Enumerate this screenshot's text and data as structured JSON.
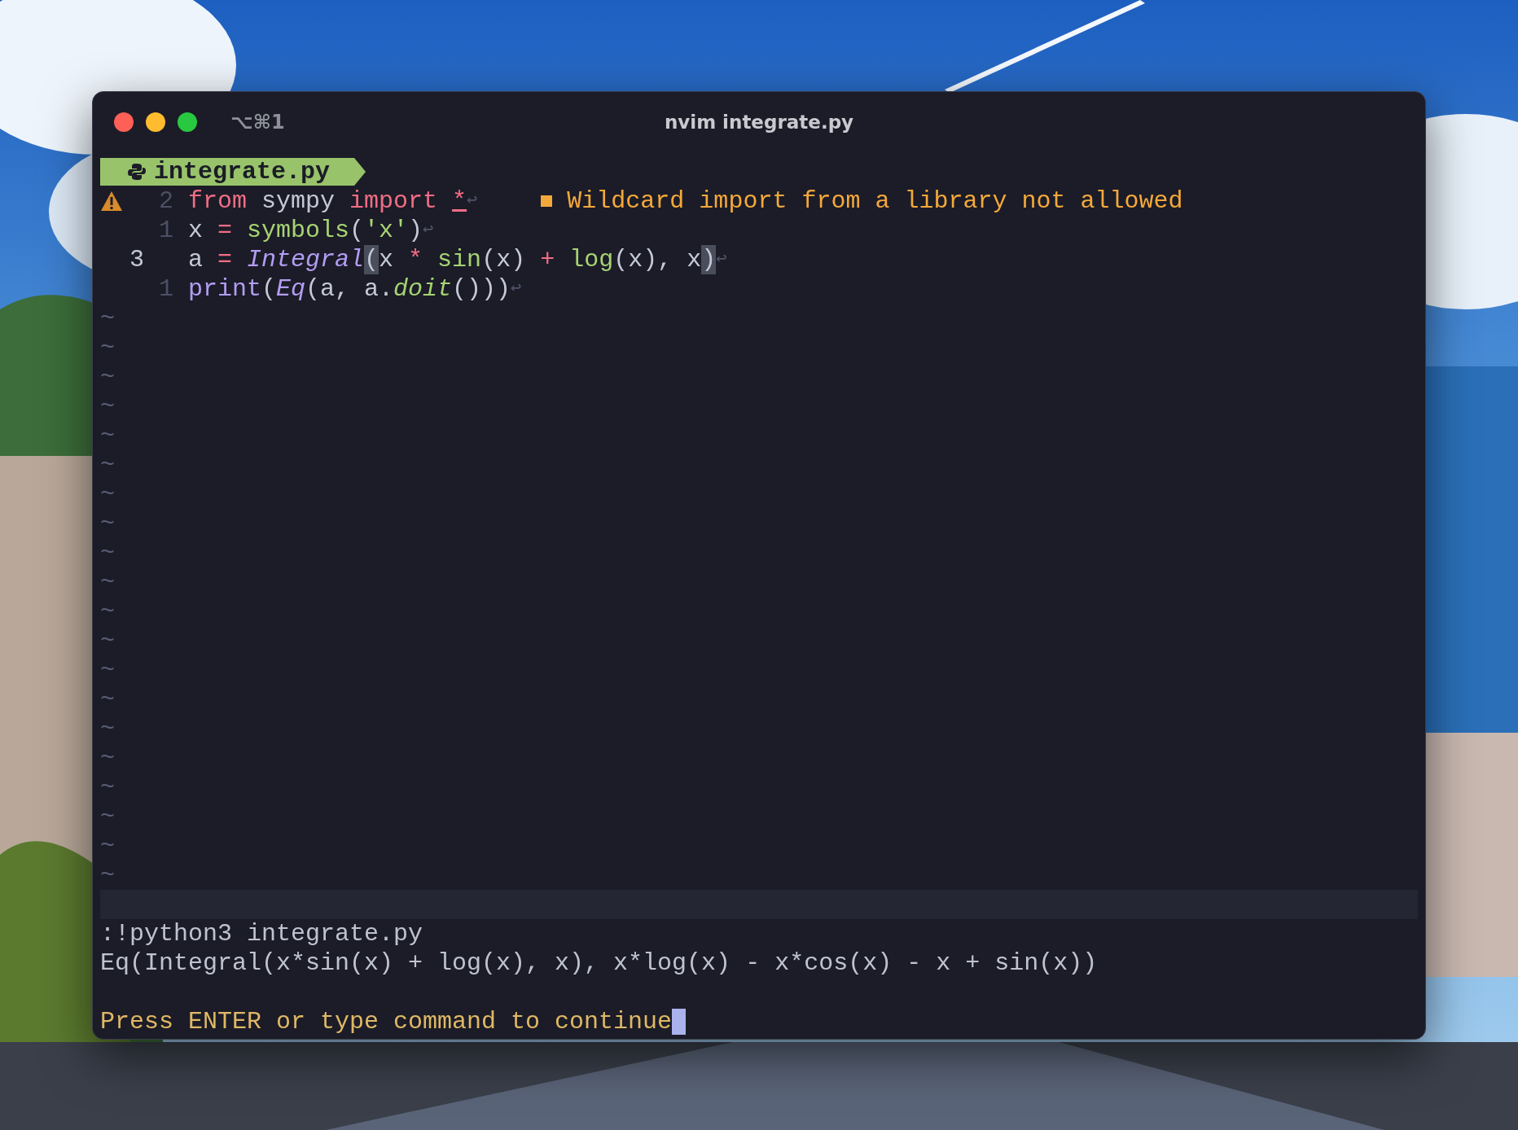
{
  "window": {
    "title": "nvim integrate.py",
    "shortcut": "⌥⌘1"
  },
  "tab": {
    "label": "integrate.py"
  },
  "lines": [
    {
      "number": "2",
      "current": false,
      "warning": true,
      "tokens": [
        {
          "text": "from",
          "kind": "keyword"
        },
        {
          "text": " sympy ",
          "kind": "ident"
        },
        {
          "text": "import ",
          "kind": "keyword"
        },
        {
          "text": "*",
          "kind": "warned"
        },
        {
          "text": "↩",
          "kind": "eol"
        }
      ],
      "diagnostic": "Wildcard import from a library not allowed"
    },
    {
      "number": "1",
      "current": false,
      "warning": false,
      "tokens": [
        {
          "text": "x ",
          "kind": "ident"
        },
        {
          "text": "=",
          "kind": "op"
        },
        {
          "text": " symbols",
          "kind": "func"
        },
        {
          "text": "(",
          "kind": "ident"
        },
        {
          "text": "'x'",
          "kind": "string"
        },
        {
          "text": ")",
          "kind": "ident"
        },
        {
          "text": "↩",
          "kind": "eol"
        }
      ]
    },
    {
      "number": "3",
      "current": true,
      "warning": false,
      "tokens": [
        {
          "text": "a ",
          "kind": "ident"
        },
        {
          "text": "=",
          "kind": "op"
        },
        {
          "text": " Integral",
          "kind": "type"
        },
        {
          "text": "(",
          "kind": "match"
        },
        {
          "text": "x ",
          "kind": "ident"
        },
        {
          "text": "*",
          "kind": "op"
        },
        {
          "text": " sin",
          "kind": "func"
        },
        {
          "text": "(x) ",
          "kind": "ident"
        },
        {
          "text": "+",
          "kind": "op"
        },
        {
          "text": " log",
          "kind": "func"
        },
        {
          "text": "(x), x",
          "kind": "ident"
        },
        {
          "text": ")",
          "kind": "match"
        },
        {
          "text": "↩",
          "kind": "eol"
        }
      ]
    },
    {
      "number": "1",
      "current": false,
      "warning": false,
      "tokens": [
        {
          "text": "print",
          "kind": "builtin"
        },
        {
          "text": "(",
          "kind": "ident"
        },
        {
          "text": "Eq",
          "kind": "type"
        },
        {
          "text": "(a, a.",
          "kind": "ident"
        },
        {
          "text": "doit",
          "kind": "method"
        },
        {
          "text": "()))",
          "kind": "ident"
        },
        {
          "text": "↩",
          "kind": "eol"
        }
      ]
    }
  ],
  "empty_lines": [
    "~",
    "~",
    "~",
    "~",
    "~",
    "~",
    "~",
    "~",
    "~",
    "~",
    "~",
    "~",
    "~",
    "~",
    "~",
    "~",
    "~",
    "~",
    "~",
    "~"
  ],
  "command_output": [
    {
      "kind": "output",
      "text": ":!python3 integrate.py"
    },
    {
      "kind": "output",
      "text": "Eq(Integral(x*sin(x) + log(x), x), x*log(x) - x*cos(x) - x + sin(x))"
    },
    {
      "kind": "blank"
    },
    {
      "kind": "prompt",
      "text": "Press ENTER or type command to continue"
    }
  ]
}
